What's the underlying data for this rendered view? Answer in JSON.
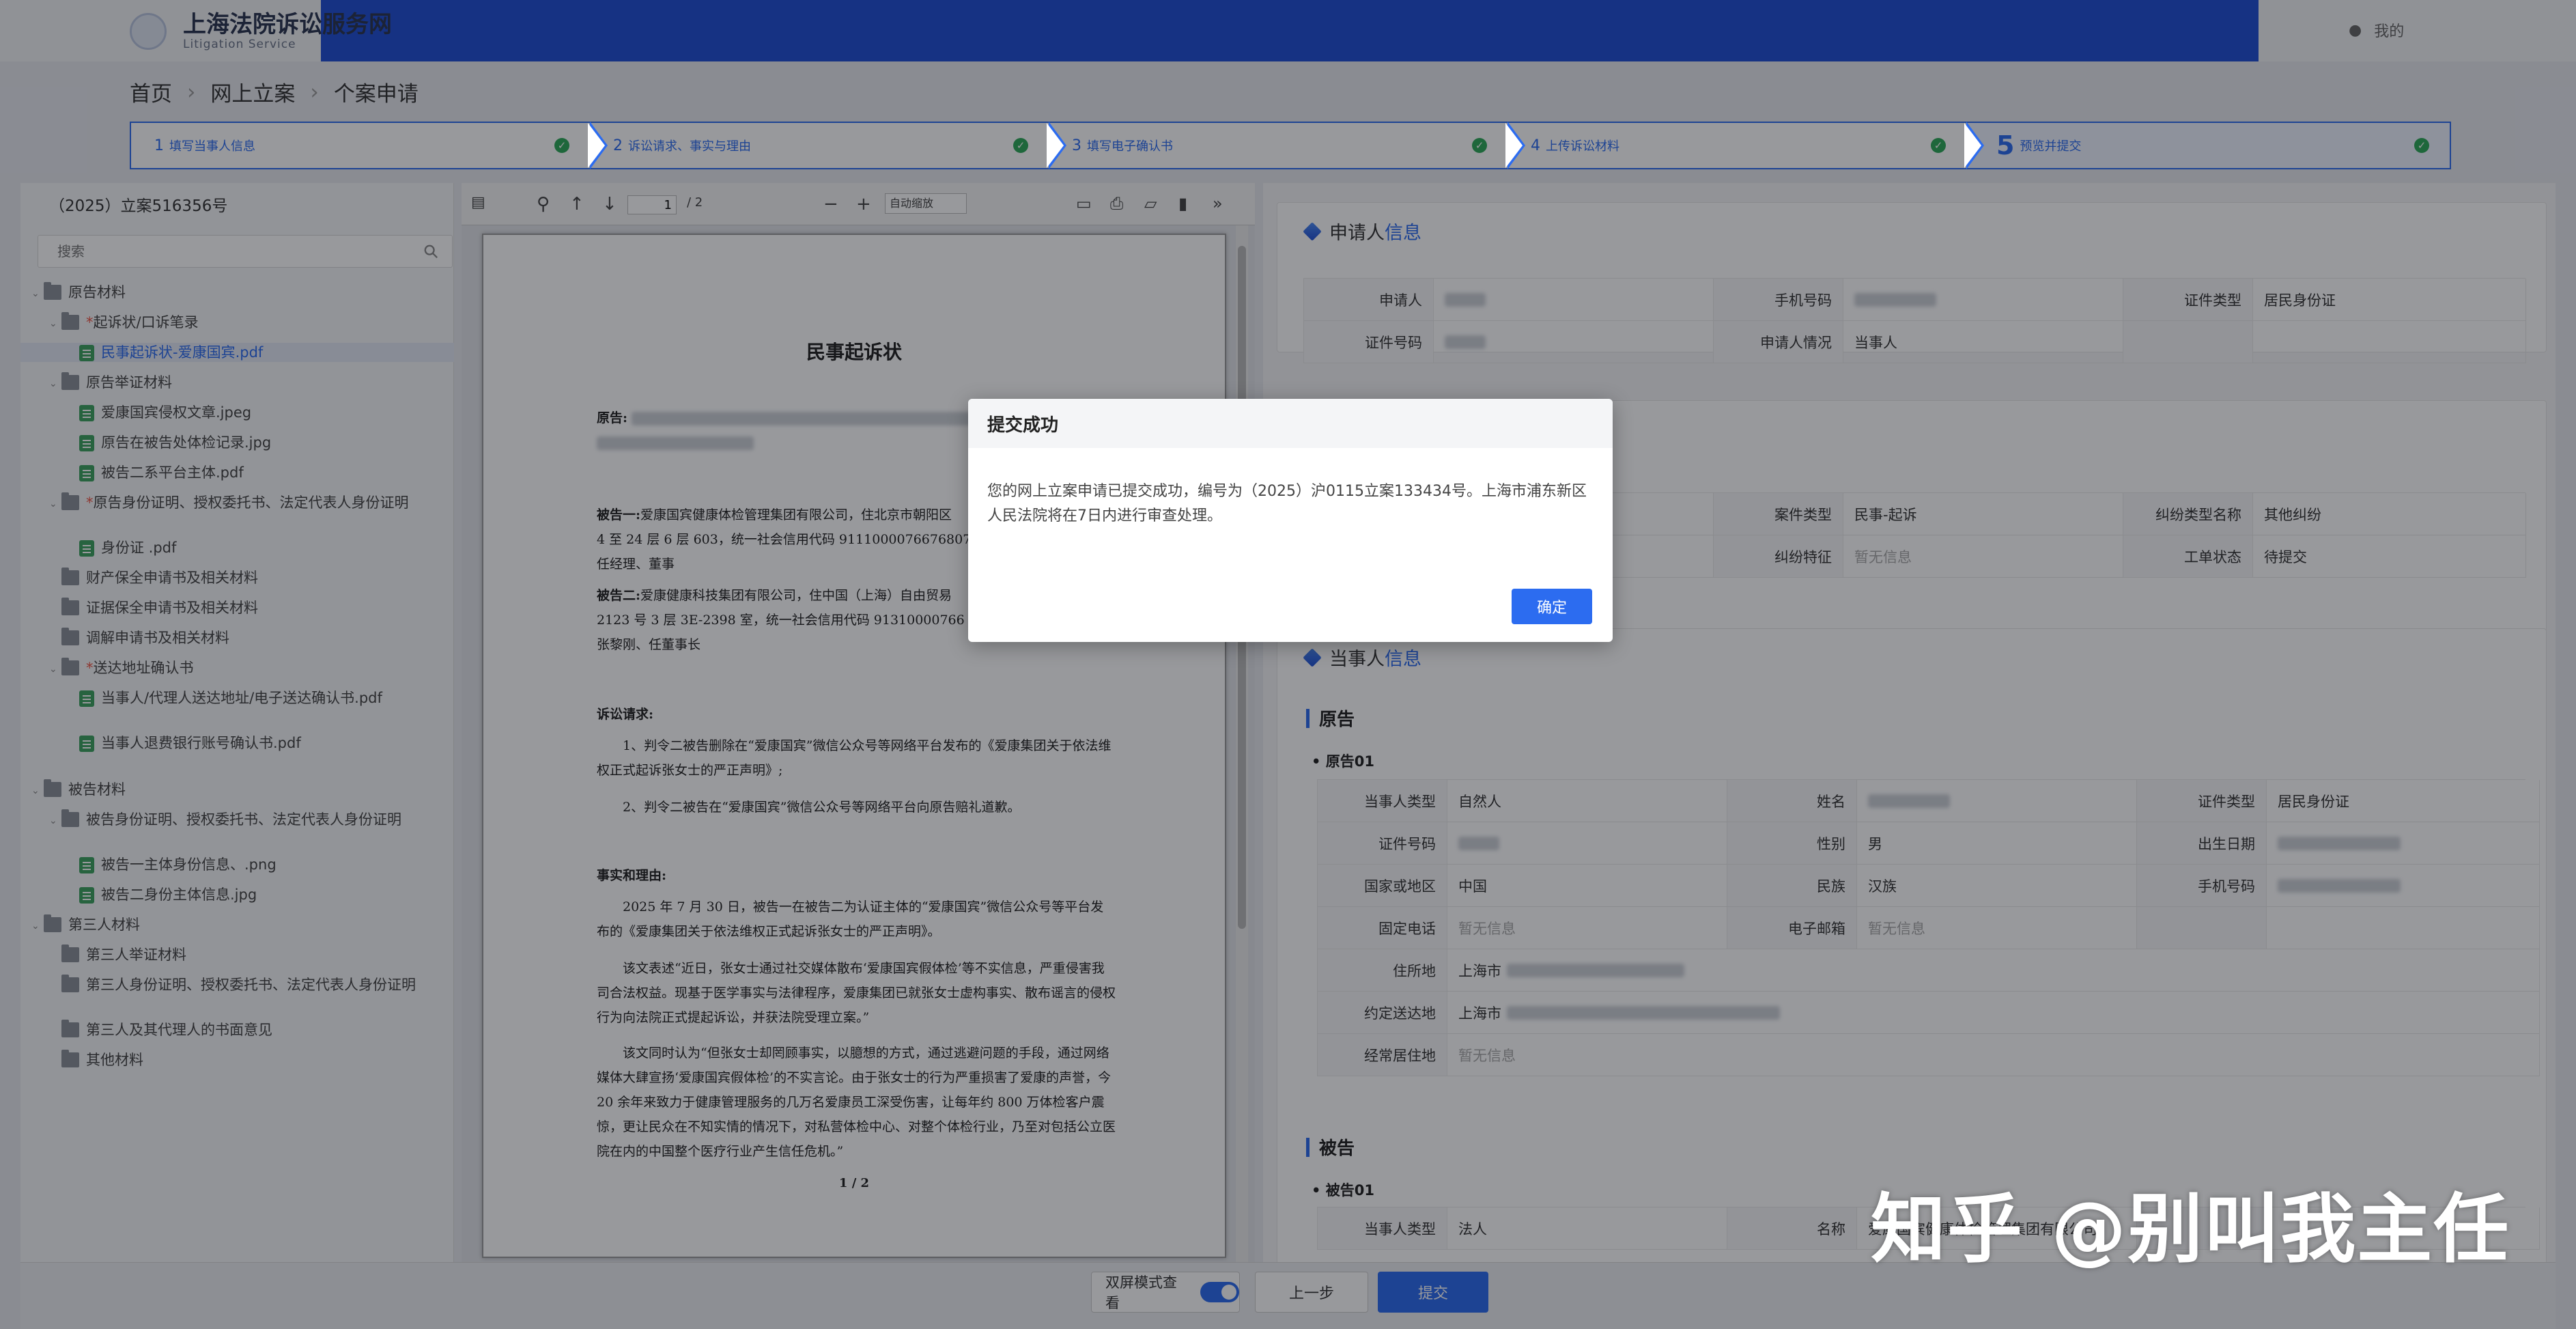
{
  "header": {
    "site_title": "上海法院诉讼服务网",
    "site_subtitle": "Litigation Service",
    "user_label": "我的"
  },
  "breadcrumb": [
    "首页",
    "网上立案",
    "个案申请"
  ],
  "steps": [
    {
      "num": "1",
      "label": "填写当事人信息"
    },
    {
      "num": "2",
      "label": "诉讼请求、事实与理由"
    },
    {
      "num": "3",
      "label": "填写电子确认书"
    },
    {
      "num": "4",
      "label": "上传诉讼材料"
    },
    {
      "num": "5",
      "label": "预览并提交"
    }
  ],
  "left_panel": {
    "case_title": "（2025）立案516356号",
    "search_placeholder": "搜索",
    "tree": [
      {
        "label": "原告材料",
        "type": "folder",
        "level": 0,
        "expanded": true
      },
      {
        "label": "起诉状/口诉笔录",
        "type": "folder",
        "level": 1,
        "required": true,
        "expanded": true
      },
      {
        "label": "民事起诉状-爱康国宾.pdf",
        "type": "file",
        "level": 2,
        "selected": true
      },
      {
        "label": "原告举证材料",
        "type": "folder",
        "level": 1,
        "expanded": true
      },
      {
        "label": "爱康国宾侵权文章.jpeg",
        "type": "file",
        "level": 2
      },
      {
        "label": "原告在被告处体检记录.jpg",
        "type": "file",
        "level": 2
      },
      {
        "label": "被告二系平台主体.pdf",
        "type": "file",
        "level": 2
      },
      {
        "label": "原告身份证明、授权委托书、法定代表人身份证明",
        "type": "folder",
        "level": 1,
        "required": true,
        "expanded": true
      },
      {
        "label": "身份证 .pdf",
        "type": "file",
        "level": 2
      },
      {
        "label": "财产保全申请书及相关材料",
        "type": "folder",
        "level": 1
      },
      {
        "label": "证据保全申请书及相关材料",
        "type": "folder",
        "level": 1
      },
      {
        "label": "调解申请书及相关材料",
        "type": "folder",
        "level": 1
      },
      {
        "label": "送达地址确认书",
        "type": "folder",
        "level": 1,
        "required": true,
        "expanded": true
      },
      {
        "label": "当事人/代理人送达地址/电子送达确认书.pdf",
        "type": "file",
        "level": 2
      },
      {
        "label": "当事人退费银行账号确认书.pdf",
        "type": "file",
        "level": 2
      },
      {
        "label": "被告材料",
        "type": "folder",
        "level": 0,
        "expanded": true
      },
      {
        "label": "被告身份证明、授权委托书、法定代表人身份证明",
        "type": "folder",
        "level": 1,
        "expanded": true
      },
      {
        "label": "被告一主体身份信息、.png",
        "type": "file",
        "level": 2
      },
      {
        "label": "被告二身份主体信息.jpg",
        "type": "file",
        "level": 2
      },
      {
        "label": "第三人材料",
        "type": "folder",
        "level": 0,
        "expanded": true
      },
      {
        "label": "第三人举证材料",
        "type": "folder",
        "level": 1
      },
      {
        "label": "第三人身份证明、授权委托书、法定代表人身份证明",
        "type": "folder",
        "level": 1
      },
      {
        "label": "第三人及其代理人的书面意见",
        "type": "folder",
        "level": 1
      },
      {
        "label": "其他材料",
        "type": "folder",
        "level": 1
      }
    ]
  },
  "pdf_viewer": {
    "current_page": "1",
    "total_pages": "/ 2",
    "zoom": "自动缩放",
    "page_footer": "1 / 2",
    "doc": {
      "title": "民事起诉状",
      "plaintiff_label": "原告:",
      "defendant1_label": "被告一:",
      "defendant1_text": "爱康国宾健康体检管理集团有限公司，住北京市朝阳区",
      "defendant1_text2": "4 至 24 层 6 层 603，统一社会信用代码 911100007667680727",
      "defendant1_text3": "任经理、董事",
      "defendant2_label": "被告二:",
      "defendant2_text": "爱康健康科技集团有限公司，住中国（上海）自由贸易",
      "defendant2_text2": "2123 号 3 层 3E-2398 室，统一社会信用代码 91310000766",
      "defendant2_text3": "张黎刚、任董事长",
      "claims_label": "诉讼请求:",
      "claim1": "1、判令二被告删除在“爱康国宾”微信公众号等网络平台发布的《爱康集团关于依法维权正式起诉张女士的严正声明》;",
      "claim2": "2、判令二被告在“爱康国宾”微信公众号等网络平台向原告赔礼道歉。",
      "facts_label": "事实和理由:",
      "fact1": "2025 年 7 月 30 日，被告一在被告二为认证主体的“爱康国宾”微信公众号等平台发布的《爱康集团关于依法维权正式起诉张女士的严正声明》。",
      "fact2": "该文表述“近日，张女士通过社交媒体散布‘爱康国宾假体检’等不实信息，严重侵害我司合法权益。现基于医学事实与法律程序，爱康集团已就张女士虚构事实、散布谣言的侵权行为向法院正式提起诉讼，并获法院受理立案。”",
      "fact3": "该文同时认为“但张女士却罔顾事实，以臆想的方式，通过逃避问题的手段，通过网络媒体大肆宣扬‘爱康国宾假体检’的不实言论。由于张女士的行为严重损害了爱康的声誉，今 20 余年来致力于健康管理服务的几万名爱康员工深受伤害，让每年约 800 万体检客户震惊，更让民众在不知实情的情况下，对私营体检中心、对整个体检行业，乃至对包括公立医院在内的中国整个医疗行业产生信任危机。”"
    }
  },
  "applicant": {
    "title_main": "申请人",
    "title_hl": "信息",
    "rows": [
      [
        {
          "label": "申请人",
          "value": ""
        },
        {
          "label": "手机号码",
          "value": ""
        },
        {
          "label": "证件类型",
          "value": "居民身份证"
        }
      ],
      [
        {
          "label": "证件号码",
          "value": ""
        },
        {
          "label": "申请人情况",
          "value": "当事人"
        }
      ]
    ]
  },
  "case_info": {
    "rows": [
      [
        {
          "label": "",
          "value": ""
        },
        {
          "label": "案件类型",
          "value": "民事-起诉"
        },
        {
          "label": "纠纷类型名称",
          "value": "其他纠纷"
        }
      ],
      [
        {
          "label": "",
          "value": ""
        },
        {
          "label": "纠纷特征",
          "value": "暂无信息",
          "muted": true
        },
        {
          "label": "工单状态",
          "value": "待提交"
        }
      ]
    ]
  },
  "parties": {
    "title_main": "当事人",
    "title_hl": "信息",
    "plaintiff_section": "原告",
    "plaintiff_sub": "原告01",
    "plaintiff_rows": [
      [
        {
          "label": "当事人类型",
          "value": "自然人"
        },
        {
          "label": "姓名",
          "value": ""
        },
        {
          "label": "证件类型",
          "value": "居民身份证"
        }
      ],
      [
        {
          "label": "证件号码",
          "value": ""
        },
        {
          "label": "性别",
          "value": "男"
        },
        {
          "label": "出生日期",
          "value": ""
        }
      ],
      [
        {
          "label": "国家或地区",
          "value": "中国"
        },
        {
          "label": "民族",
          "value": "汉族"
        },
        {
          "label": "手机号码",
          "value": ""
        }
      ],
      [
        {
          "label": "固定电话",
          "value": "暂无信息",
          "muted": true
        },
        {
          "label": "电子邮箱",
          "value": "暂无信息",
          "muted": true
        }
      ]
    ],
    "plaintiff_wide_rows": [
      {
        "label": "住所地",
        "value": "上海市"
      },
      {
        "label": "约定送达地",
        "value": "上海市"
      },
      {
        "label": "经常居住地",
        "value": "暂无信息",
        "muted": true
      }
    ],
    "defendant_section": "被告",
    "defendant_sub": "被告01",
    "defendant_rows": [
      [
        {
          "label": "当事人类型",
          "value": "法人"
        },
        {
          "label": "名称",
          "value": "爱康国宾健康体检管理集团有限公司"
        }
      ]
    ]
  },
  "modal": {
    "title": "提交成功",
    "message": "您的网上立案申请已提交成功，编号为（2025）沪0115立案133434号。上海市浦东新区人民法院将在7日内进行审查处理。",
    "ok_label": "确定"
  },
  "bottom": {
    "dual_screen_label": "双屏模式查看",
    "prev_label": "上一步",
    "submit_label": "提交"
  },
  "watermark": "知乎 @别叫我主任",
  "colors": {
    "primary": "#2c6cf0",
    "header_blue": "#1f4fd4",
    "success": "#2eaa58"
  }
}
